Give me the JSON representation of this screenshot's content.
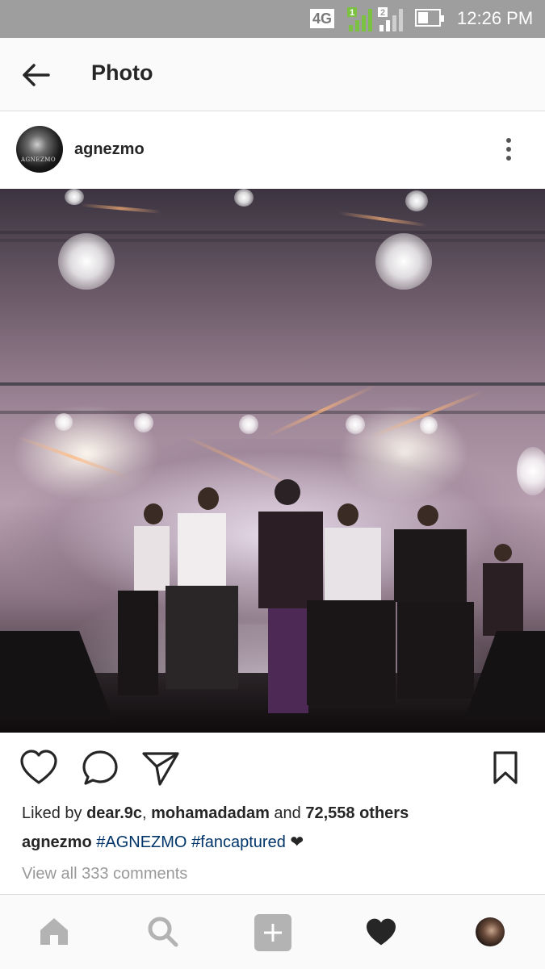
{
  "status_bar": {
    "network": "4G",
    "sim1_label": "1",
    "sim2_label": "2",
    "time": "12:26 PM"
  },
  "header": {
    "title": "Photo"
  },
  "post": {
    "username": "agnezmo",
    "avatar_text": "AGNEZMO",
    "likes": {
      "prefix": "Liked by ",
      "user1": "dear.9c",
      "separator": ", ",
      "user2": "mohamadadam",
      "and_text": " and ",
      "others": "72,558 others"
    },
    "caption": {
      "user": "agnezmo",
      "tag1": "#AGNEZMO",
      "tag2": "#fancaptured",
      "emoji": "❤"
    },
    "comments_link": "View all 333 comments"
  },
  "colors": {
    "hashtag": "#003569",
    "muted": "#999999",
    "status_bar_bg": "#9e9e9e",
    "signal_green": "#7cc242"
  },
  "icons": {
    "back": "arrow-left-icon",
    "more": "vertical-dots-icon",
    "like": "heart-outline-icon",
    "comment": "speech-bubble-icon",
    "share": "paper-plane-icon",
    "save": "bookmark-icon",
    "nav": [
      "home-icon",
      "search-icon",
      "add-icon",
      "heart-filled-icon",
      "profile-avatar"
    ]
  }
}
